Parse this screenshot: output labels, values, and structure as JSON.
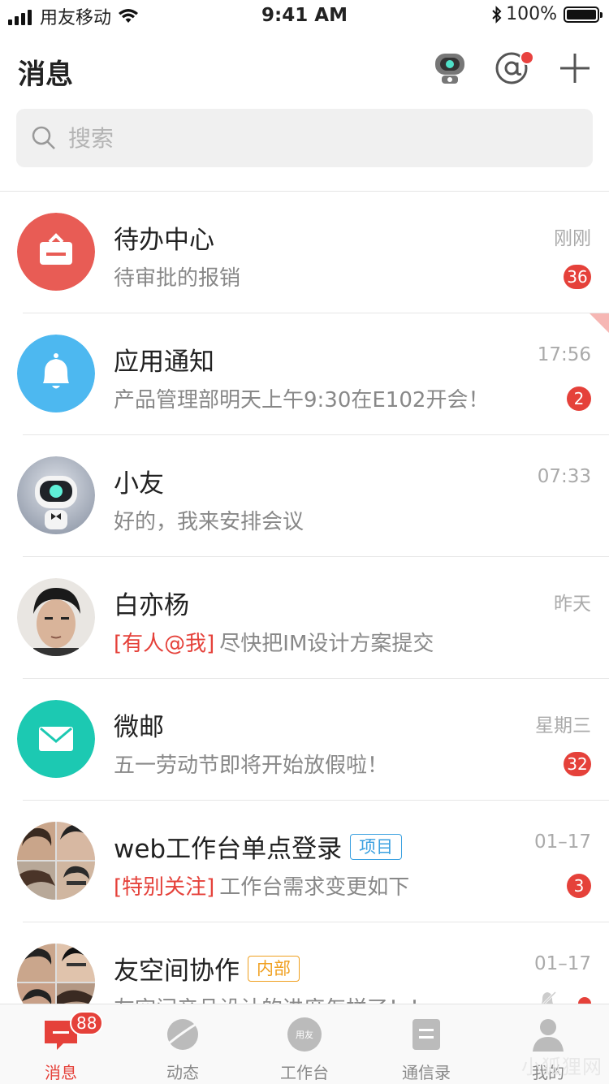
{
  "status_bar": {
    "carrier": "用友移动",
    "time": "9:41 AM",
    "battery": "100%"
  },
  "header": {
    "title": "消息"
  },
  "search": {
    "placeholder": "搜索"
  },
  "conversations": [
    {
      "title": "待办中心",
      "subtitle": "待审批的报销",
      "time": "刚刚",
      "badge": "36",
      "avatar": "todo-icon",
      "color": "#e85c55"
    },
    {
      "title": "应用通知",
      "subtitle": "产品管理部明天上午9:30在E102开会！",
      "time": "17:56",
      "badge": "2",
      "avatar": "bell-icon",
      "color": "#4db8f0"
    },
    {
      "title": "小友",
      "subtitle": "好的，我来安排会议",
      "time": "07:33",
      "avatar": "robot-avatar"
    },
    {
      "title": "白亦杨",
      "mention": "[有人@我]",
      "subtitle": "尽快把IM设计方案提交",
      "time": "昨天",
      "avatar": "user-photo"
    },
    {
      "title": "微邮",
      "subtitle": "五一劳动节即将开始放假啦！",
      "time": "星期三",
      "badge": "32",
      "avatar": "mail-icon",
      "color": "#1cc9b2"
    },
    {
      "title": "web工作台单点登录",
      "tag": "项目",
      "mention": "[特别关注]",
      "subtitle": "工作台需求变更如下",
      "time": "01–17",
      "badge": "3",
      "avatar": "group-photo"
    },
    {
      "title": "友空间协作",
      "tag": "内部",
      "subtitle": "友空间产品设计的进度怎样了！！",
      "time": "01–17",
      "avatar": "group-photo"
    }
  ],
  "tabbar": {
    "tabs": [
      {
        "label": "消息",
        "badge": "88",
        "icon": "message-icon"
      },
      {
        "label": "动态",
        "icon": "planet-icon"
      },
      {
        "label": "工作台",
        "icon": "workbench-icon",
        "icon_text": "用友"
      },
      {
        "label": "通信录",
        "icon": "contacts-icon"
      },
      {
        "label": "我的",
        "icon": "profile-icon"
      }
    ]
  },
  "watermark": "小狐狸网",
  "colors": {
    "accent": "#e5413a",
    "blue_tag": "#3aa0e0",
    "orange_tag": "#f0a020"
  }
}
